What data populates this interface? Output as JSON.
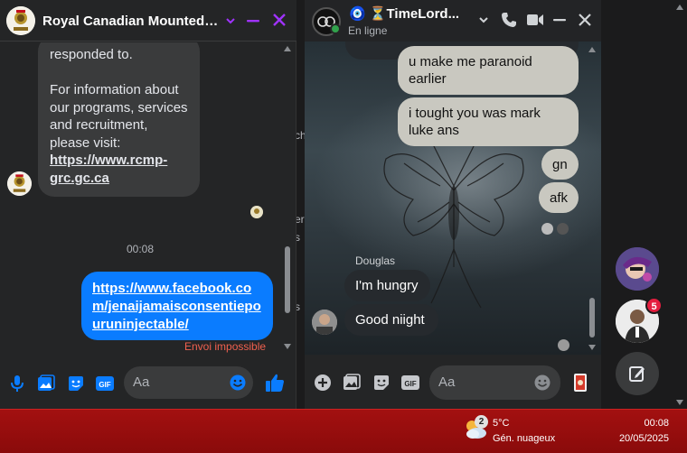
{
  "left_chat": {
    "title": "Royal Canadian Mounted ...",
    "message_part1": "responded to.",
    "message_part2": "For information about our programs, services and recruitment, please visit:",
    "message_link": "https://www.rcmp-grc.gc.ca",
    "time_separator": "00:08",
    "sent_link": "https://www.facebook.com/jenaijamaisconsentiepouruninjectable/",
    "send_failed": "Envoi impossible",
    "composer_placeholder": "Aa"
  },
  "mid_chat": {
    "title": "🧿 ⏳TimeLord...",
    "status": "En ligne",
    "messages_sent": [
      "u make me paranoid earlier",
      "i tought you was mark luke ans",
      "gn",
      "afk"
    ],
    "sender_name": "Douglas",
    "messages_received": [
      "I'm hungry",
      "Good niight"
    ],
    "composer_placeholder": "Aa"
  },
  "chat_heads": {
    "badge_count": "5"
  },
  "taskbar": {
    "weather_badge": "2",
    "temperature": "5°C",
    "weather_desc": "Gén. nuageux",
    "time": "00:08",
    "date": "20/05/2025"
  },
  "background_peek": {
    "line1": "ch",
    "line2": "er",
    "line3": "s",
    "line4": "s"
  },
  "colors": {
    "accent": "#0a7cff",
    "purple_icons": "#a033ff",
    "taskbar": "#a31010",
    "error": "#f0604f",
    "like": "#0a7cff"
  }
}
